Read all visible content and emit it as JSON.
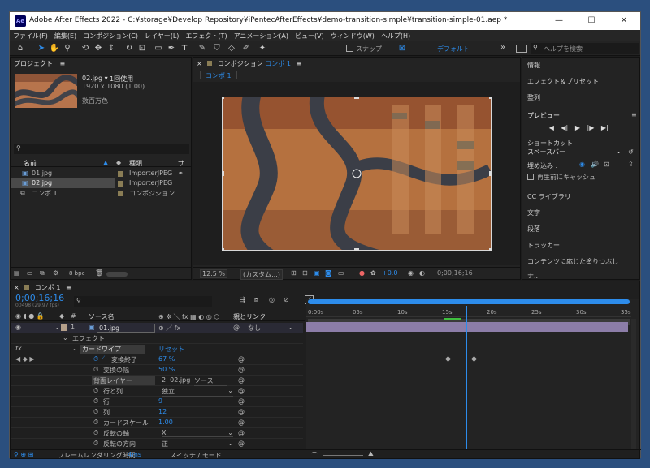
{
  "window": {
    "title": "Adobe After Effects 2022 - C:¥storage¥Develop Repository¥iPentecAfterEffects¥demo-transition-simple¥transition-simple-01.aep *",
    "logo": "Ae",
    "min": "—",
    "max": "☐",
    "close": "✕"
  },
  "menu": [
    "ファイル(F)",
    "編集(E)",
    "コンポジション(C)",
    "レイヤー(L)",
    "エフェクト(T)",
    "アニメーション(A)",
    "ビュー(V)",
    "ウィンドウ(W)",
    "ヘルプ(H)"
  ],
  "toolbar": {
    "snap_label": "スナップ",
    "workspace": "デフォルト",
    "more": "»",
    "search_placeholder": "ヘルプを検索"
  },
  "project": {
    "title": "プロジェクト",
    "menu": "≡",
    "thumb_name": "02.jpg ▾",
    "thumb_usage": "1回使用",
    "thumb_dims": "1920 x 1080 (1.00)",
    "thumb_colors": "数百万色",
    "search_placeholder": "",
    "col_name": "名前",
    "col_type": "種類",
    "col_size": "サ",
    "items": [
      {
        "name": "01.jpg",
        "type": "ImporterJPEG",
        "selected": false
      },
      {
        "name": "02.jpg",
        "type": "ImporterJPEG",
        "selected": true
      },
      {
        "name": "コンポ 1",
        "type": "コンポジション",
        "selected": false
      }
    ],
    "bpc": "8 bpc"
  },
  "comp": {
    "title": "コンポジション",
    "name": "コンポ 1",
    "menu": "≡",
    "tab": "コンポ 1",
    "zoom": "12.5 %",
    "resolution": "(カスタム...)",
    "exposure": "+0.0",
    "timecode": "0;00;16;16"
  },
  "right": {
    "items": [
      "情報",
      "エフェクト＆プリセット",
      "整列"
    ],
    "preview_title": "プレビュー",
    "preview_menu": "≡",
    "preview_buttons": [
      "|◀",
      "◀|",
      "▶",
      "|▶",
      "▶|"
    ],
    "shortcut_label": "ショートカット",
    "shortcut_value": "スペースバー",
    "include_label": "埋め込み :",
    "cache_label": "再生前にキャッシュ",
    "items2": [
      "CC ライブラリ",
      "文字",
      "段落",
      "トラッカー",
      "コンテンツに応じた塗りつぶし",
      "ナ..."
    ]
  },
  "timeline": {
    "tab": "コンポ 1",
    "menu": "≡",
    "timecode": "0;00;16;16",
    "frames": "00498 (29.97 fps)",
    "search_placeholder": "",
    "col_source": "ソース名",
    "col_parent": "親とリンク",
    "layer_num": "1",
    "layer_name": "01.jpg",
    "parent_value": "なし",
    "effects_label": "エフェクト",
    "fx": "fx",
    "effect_name": "カードワイプ",
    "reset": "リセット",
    "properties": [
      {
        "name": "変換終了",
        "value": "67 %",
        "keyed": true
      },
      {
        "name": "変換の幅",
        "value": "50 %",
        "keyed": false
      },
      {
        "name": "背面レイヤー",
        "value": "2. 02.jpg",
        "extra": "ソース",
        "dropdown": true
      },
      {
        "name": "行と列",
        "value": "独立",
        "dropdown": true
      },
      {
        "name": "行",
        "value": "9"
      },
      {
        "name": "列",
        "value": "12"
      },
      {
        "name": "カードスケール",
        "value": "1.00"
      },
      {
        "name": "反転の軸",
        "value": "X",
        "dropdown": true
      },
      {
        "name": "反転の方向",
        "value": "正",
        "dropdown": true
      }
    ],
    "ruler": [
      "0:00s",
      "05s",
      "10s",
      "15s",
      "20s",
      "25s",
      "30s",
      "35s"
    ],
    "playhead_pct": 0.493,
    "keyframes_pct": [
      0.435,
      0.515
    ],
    "footer_label": "フレームレンダリング時間",
    "footer_time": "4ms",
    "footer_switch": "スイッチ / モード"
  },
  "colors": {
    "accent": "#2d8ceb",
    "layer_bar": "#8c7da8",
    "playhead": "#2d8ceb"
  }
}
